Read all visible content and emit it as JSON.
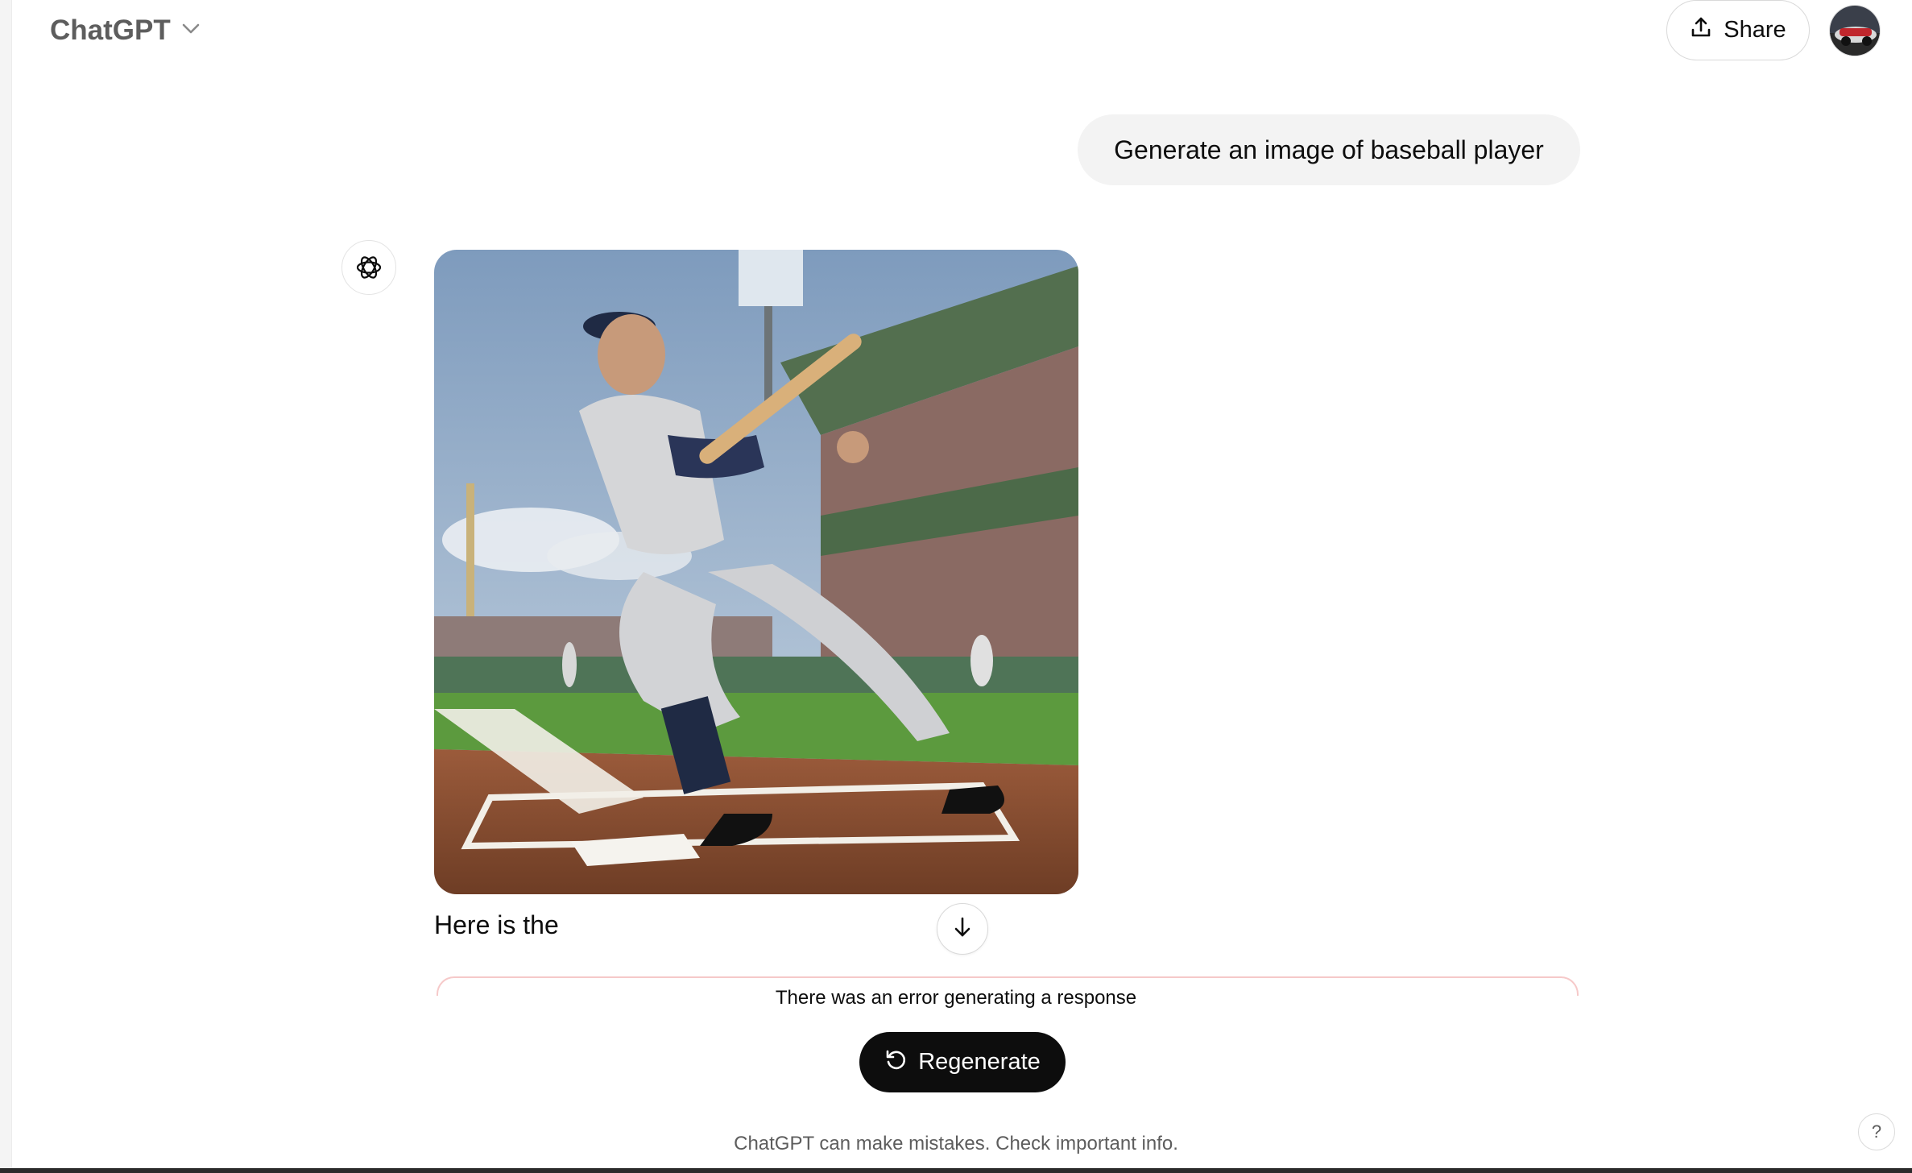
{
  "header": {
    "model_name": "ChatGPT",
    "chevron_icon": "chevron-down-icon",
    "share_label": "Share",
    "share_icon": "upload-icon"
  },
  "conversation": {
    "user_message": "Generate an image of baseball player",
    "assistant_icon": "openai-logo-icon",
    "response_text": "Here is the",
    "scroll_icon": "arrow-down-icon"
  },
  "error": {
    "message": "There was an error generating a response",
    "regenerate_label": "Regenerate",
    "regenerate_icon": "refresh-icon"
  },
  "footer": {
    "disclaimer": "ChatGPT can make mistakes. Check important info.",
    "help_label": "?"
  },
  "colors": {
    "accent_dark": "#0d0d0d",
    "bubble_bg": "#f3f3f3",
    "error_border": "#f6c9c9"
  }
}
